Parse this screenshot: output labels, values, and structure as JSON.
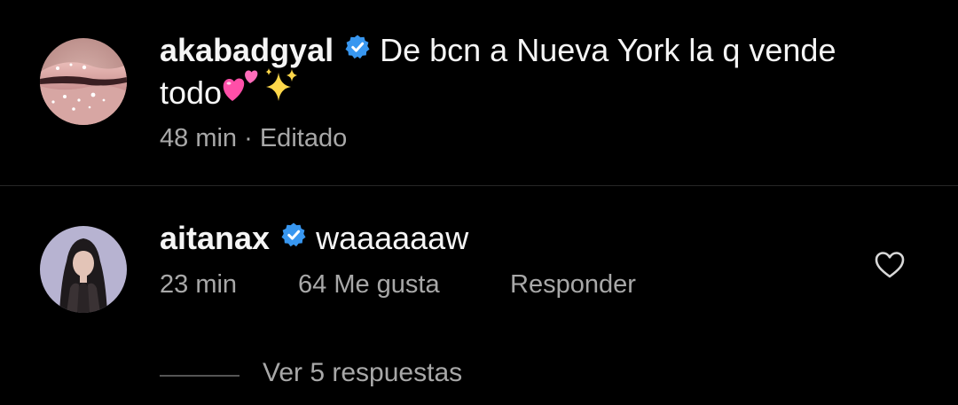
{
  "post": {
    "username": "akabadgyal",
    "caption_part1": "De bcn a Nueva York la q vende",
    "caption_part2": "todo",
    "time": "48 min",
    "separator": "·",
    "edited": "Editado"
  },
  "comment": {
    "username": "aitanax",
    "text": "waaaaaaw",
    "time": "23 min",
    "likes": "64 Me gusta",
    "reply_label": "Responder",
    "view_replies": "Ver 5 respuestas"
  },
  "icons": {
    "verified": "verified-badge-icon",
    "heart": "heart-outline-icon",
    "emoji1": "two-hearts-emoji",
    "emoji2": "sparkles-emoji"
  },
  "colors": {
    "background": "#000000",
    "text": "#f5f5f5",
    "secondary_text": "#a8a8a8",
    "verified_blue": "#3897f0",
    "divider": "#262626",
    "heart_pink": "#ff4fa8",
    "sparkle_yellow": "#ffd84a"
  }
}
